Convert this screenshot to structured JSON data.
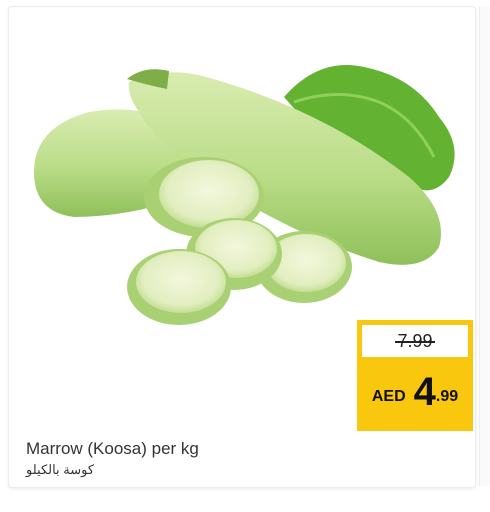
{
  "product": {
    "name_en": "Marrow (Koosa) per kg",
    "name_ar": "كوسة بالكيلو",
    "image_icon": "zucchini-image"
  },
  "price": {
    "old": "7.99",
    "currency": "AED",
    "integer": "4",
    "decimal": ".99"
  },
  "colors": {
    "price_tag": "#f9c80e",
    "zucchini_light": "#cfe6a1",
    "zucchini_dark": "#8fc05a",
    "leaf": "#5fae2e"
  }
}
